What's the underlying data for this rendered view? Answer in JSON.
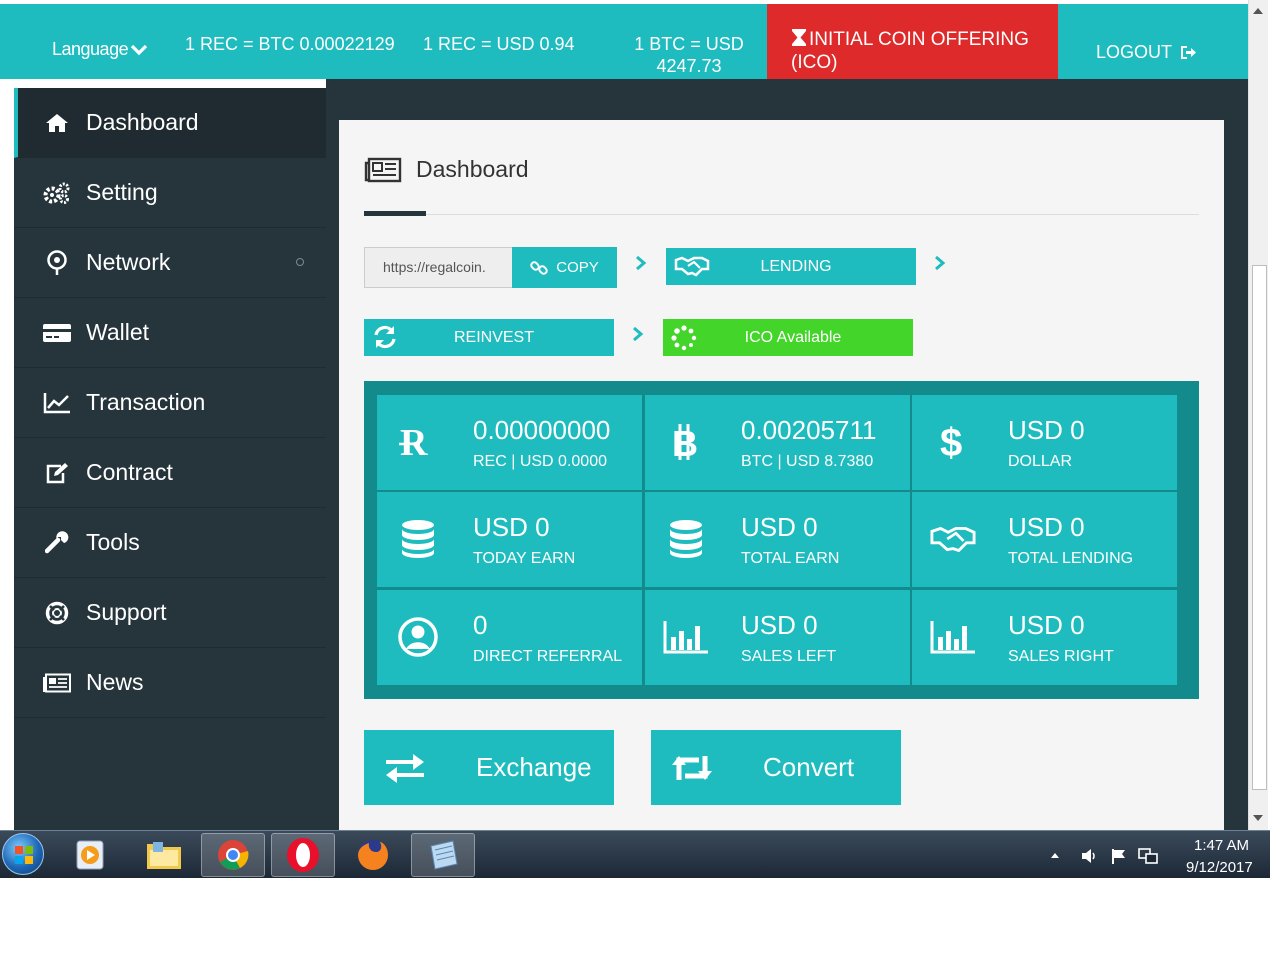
{
  "topbar": {
    "language_label": "Language",
    "rate_rec_btc": "1 REC = BTC 0.00022129",
    "rate_rec_usd": "1 REC = USD 0.94",
    "rate_btc_usd_line1": "1 BTC = USD",
    "rate_btc_usd_line2": "4247.73",
    "ico_line1": "INITIAL COIN OFFERING",
    "ico_line2": "(ICO)",
    "logout": "LOGOUT"
  },
  "sidebar": {
    "items": [
      {
        "label": "Dashboard",
        "icon": "home-icon",
        "active": true
      },
      {
        "label": "Setting",
        "icon": "gears-icon"
      },
      {
        "label": "Network",
        "icon": "pin-icon"
      },
      {
        "label": "Wallet",
        "icon": "credit-card-icon"
      },
      {
        "label": "Transaction",
        "icon": "line-chart-icon"
      },
      {
        "label": "Contract",
        "icon": "edit-icon"
      },
      {
        "label": "Tools",
        "icon": "wrench-icon"
      },
      {
        "label": "Support",
        "icon": "life-ring-icon"
      },
      {
        "label": "News",
        "icon": "newspaper-icon"
      }
    ]
  },
  "main": {
    "title": "Dashboard",
    "ref_link_value": "https://regalcoin.",
    "copy_label": "COPY",
    "lending_label": "LENDING",
    "reinvest_label": "REINVEST",
    "ico_available_label": "ICO Available",
    "stats": [
      {
        "value": "0.00000000",
        "label": "REC | USD 0.0000",
        "icon": "rec-coin-icon"
      },
      {
        "value": "0.00205711",
        "label": "BTC | USD 8.7380",
        "icon": "bitcoin-icon"
      },
      {
        "value": "USD 0",
        "label": "DOLLAR",
        "icon": "dollar-icon"
      },
      {
        "value": "USD 0",
        "label": "TODAY EARN",
        "icon": "database-icon"
      },
      {
        "value": "USD 0",
        "label": "TOTAL EARN",
        "icon": "database-icon"
      },
      {
        "value": "USD 0",
        "label": "TOTAL LENDING",
        "icon": "handshake-icon"
      },
      {
        "value": "0",
        "label": "DIRECT REFERRAL",
        "icon": "user-circle-icon"
      },
      {
        "value": "USD 0",
        "label": "SALES LEFT",
        "icon": "bar-chart-icon"
      },
      {
        "value": "USD 0",
        "label": "SALES RIGHT",
        "icon": "bar-chart-icon"
      }
    ],
    "exchange_label": "Exchange",
    "convert_label": "Convert"
  },
  "taskbar": {
    "time": "1:47 AM",
    "date": "9/12/2017"
  },
  "colors": {
    "teal": "#1fbcbf",
    "dark_teal": "#138a8c",
    "sidebar": "#26343c",
    "ico_red": "#de2a2a",
    "ico_green": "#44d52a"
  }
}
